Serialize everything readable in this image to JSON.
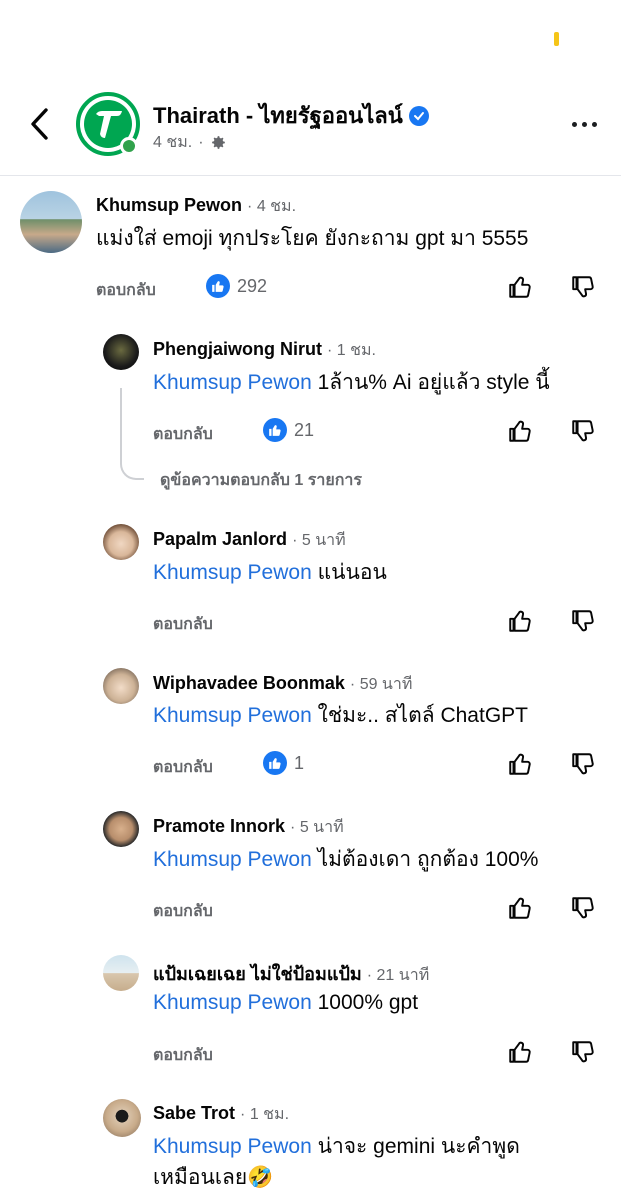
{
  "header": {
    "page_name": "Thairath - ไทยรัฐออนไลน์",
    "time": "4 ชม.",
    "separator": "·",
    "icons": {
      "back": "chevron-left-icon",
      "verified": "verified-badge-icon",
      "audience": "gear-icon",
      "more": "more-horizontal-icon"
    },
    "colors": {
      "brand": "#00a651",
      "verified": "#1877f2",
      "mention": "#216fdb"
    }
  },
  "comments": [
    {
      "name": "Khumsup Pewon",
      "time": "4 ชม.",
      "text": "แม่งใส่ emoji ทุกประโยค ยังกะถาม gpt มา 5555",
      "reply": "ตอบกลับ",
      "likes": "292"
    },
    {
      "name": "Phengjaiwong Nirut",
      "time": "1 ชม.",
      "mention": "Khumsup Pewon",
      "text": "1ล้าน% Ai อยู่แล้ว style นี้",
      "reply": "ตอบกลับ",
      "likes": "21",
      "view_replies": "ดูข้อความตอบกลับ 1 รายการ"
    },
    {
      "name": "Papalm Janlord",
      "time": "5 นาที",
      "mention": "Khumsup Pewon",
      "text": "แน่นอน",
      "reply": "ตอบกลับ"
    },
    {
      "name": "Wiphavadee Boonmak",
      "time": "59 นาที",
      "mention": "Khumsup Pewon",
      "text": "ใช่มะ.. สไตล์ ChatGPT",
      "reply": "ตอบกลับ",
      "likes": "1"
    },
    {
      "name": "Pramote Innork",
      "time": "5 นาที",
      "mention": "Khumsup Pewon",
      "text": "ไม่ต้องเดา ถูกต้อง 100%",
      "reply": "ตอบกลับ"
    },
    {
      "name": "แป้มเฉยเฉย ไม่ใช่ป้อมแป้ม",
      "time": "21 นาที",
      "mention": "Khumsup Pewon",
      "text": "1000% gpt",
      "reply": "ตอบกลับ"
    },
    {
      "name": "Sabe Trot",
      "time": "1 ชม.",
      "mention": "Khumsup Pewon",
      "text": "น่าจะ gemini นะคำพูด",
      "text2": "เหมือนเลย🤣"
    }
  ]
}
